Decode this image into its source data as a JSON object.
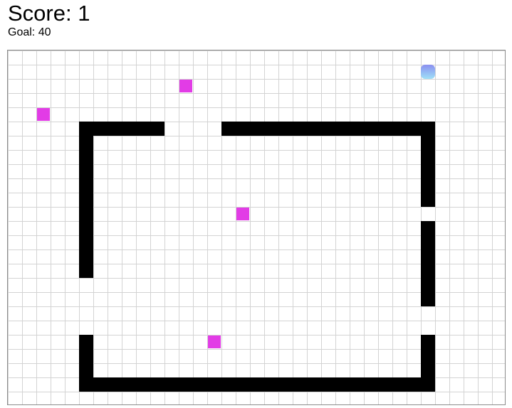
{
  "hud": {
    "score_text": "Score: 1",
    "goal_text": "Goal: 40",
    "score": 1,
    "goal": 40
  },
  "board": {
    "columns": 35,
    "rows": 25,
    "grid_line_color": "#d3d3d3",
    "border_color": "#8c8c8c"
  },
  "colors": {
    "wall": "#000000",
    "food": "#e23ce6",
    "snake_head_top": "#8a8ff0",
    "snake_head_bottom": "#9fe0f7"
  },
  "snake": {
    "head_cell": [
      29,
      1
    ],
    "length": 1
  },
  "food_cells": [
    [
      12,
      2
    ],
    [
      2,
      4
    ],
    [
      16,
      11
    ],
    [
      14,
      20
    ]
  ],
  "wall_segments": [
    {
      "cells": [
        [
          5,
          5
        ],
        [
          10,
          5
        ]
      ]
    },
    {
      "cells": [
        [
          15,
          5
        ],
        [
          29,
          5
        ]
      ]
    },
    {
      "cells": [
        [
          5,
          6
        ],
        [
          5,
          15
        ]
      ]
    },
    {
      "cells": [
        [
          29,
          6
        ],
        [
          29,
          10
        ]
      ]
    },
    {
      "cells": [
        [
          29,
          12
        ],
        [
          29,
          17
        ]
      ]
    },
    {
      "cells": [
        [
          5,
          20
        ],
        [
          5,
          23
        ]
      ]
    },
    {
      "cells": [
        [
          6,
          23
        ],
        [
          29,
          23
        ]
      ]
    },
    {
      "cells": [
        [
          29,
          20
        ],
        [
          29,
          22
        ]
      ]
    }
  ]
}
